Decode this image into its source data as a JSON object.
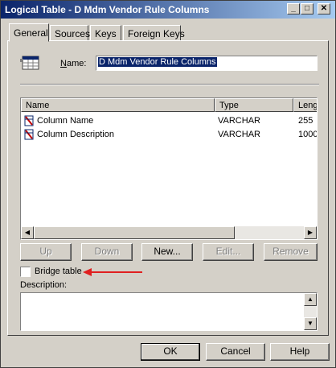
{
  "window": {
    "title": "Logical Table - D Mdm Vendor Rule Columns",
    "controls": {
      "minimize": "_",
      "maximize": "□",
      "close": "✕"
    }
  },
  "tabs": [
    {
      "label": "General",
      "active": true
    },
    {
      "label": "Sources",
      "active": false
    },
    {
      "label": "Keys",
      "active": false
    },
    {
      "label": "Foreign Keys",
      "active": false
    }
  ],
  "general": {
    "table_icon": "table-icon",
    "name_label": "Name:",
    "name_value": "D Mdm Vendor Rule Columns"
  },
  "columns_list": {
    "headers": [
      "Name",
      "Type",
      "Leng"
    ],
    "rows": [
      {
        "icon": "column-icon",
        "name": "Column Name",
        "type": "VARCHAR",
        "length": "255"
      },
      {
        "icon": "column-icon",
        "name": "Column Description",
        "type": "VARCHAR",
        "length": "1000"
      }
    ]
  },
  "list_buttons": {
    "up": "Up",
    "down": "Down",
    "new": "New...",
    "edit": "Edit...",
    "remove": "Remove"
  },
  "bridge_table": {
    "label": "Bridge table",
    "checked": false
  },
  "annotation": {
    "arrow_color": "#e02020"
  },
  "description": {
    "label": "Description:",
    "value": ""
  },
  "dialog_buttons": {
    "ok": "OK",
    "cancel": "Cancel",
    "help": "Help"
  },
  "colors": {
    "titlebar_start": "#0a246a",
    "titlebar_end": "#a6caf0",
    "face": "#d4d0c8"
  }
}
